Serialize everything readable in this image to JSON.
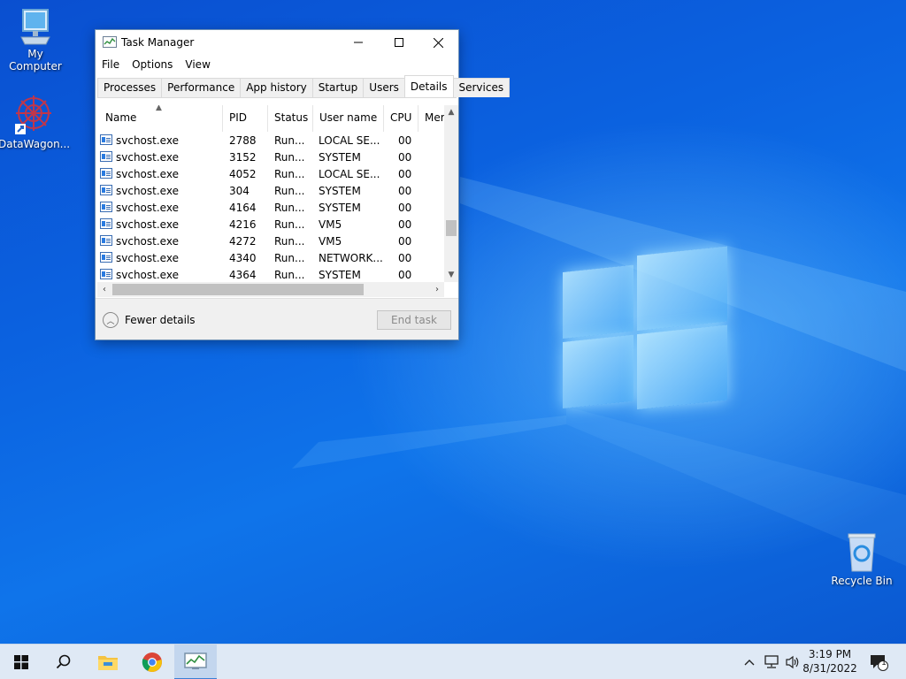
{
  "desktop": {
    "icons": [
      {
        "label": "My Computer"
      },
      {
        "label": "DataWagon..."
      },
      {
        "label": "Recycle Bin"
      }
    ]
  },
  "window": {
    "title": "Task Manager",
    "menu": [
      "File",
      "Options",
      "View"
    ],
    "tabs": [
      "Processes",
      "Performance",
      "App history",
      "Startup",
      "Users",
      "Details",
      "Services"
    ],
    "active_tab": "Details",
    "columns": [
      "Name",
      "PID",
      "Status",
      "User name",
      "CPU",
      "Mer"
    ],
    "rows": [
      {
        "name": "svchost.exe",
        "pid": "2788",
        "status": "Run...",
        "user": "LOCAL SE...",
        "cpu": "00"
      },
      {
        "name": "svchost.exe",
        "pid": "3152",
        "status": "Run...",
        "user": "SYSTEM",
        "cpu": "00"
      },
      {
        "name": "svchost.exe",
        "pid": "4052",
        "status": "Run...",
        "user": "LOCAL SE...",
        "cpu": "00"
      },
      {
        "name": "svchost.exe",
        "pid": "304",
        "status": "Run...",
        "user": "SYSTEM",
        "cpu": "00"
      },
      {
        "name": "svchost.exe",
        "pid": "4164",
        "status": "Run...",
        "user": "SYSTEM",
        "cpu": "00"
      },
      {
        "name": "svchost.exe",
        "pid": "4216",
        "status": "Run...",
        "user": "VM5",
        "cpu": "00"
      },
      {
        "name": "svchost.exe",
        "pid": "4272",
        "status": "Run...",
        "user": "VM5",
        "cpu": "00"
      },
      {
        "name": "svchost.exe",
        "pid": "4340",
        "status": "Run...",
        "user": "NETWORK...",
        "cpu": "00"
      },
      {
        "name": "svchost.exe",
        "pid": "4364",
        "status": "Run...",
        "user": "SYSTEM",
        "cpu": "00"
      }
    ],
    "fewer_details_label": "Fewer details",
    "end_task_label": "End task"
  },
  "taskbar": {
    "time": "3:19 PM",
    "date": "8/31/2022",
    "notification_count": "1"
  },
  "colors": {
    "taskbar_bg": "#dfe9f5",
    "accent": "#3c7fd6",
    "desktop_blue": "#0b62e0"
  }
}
